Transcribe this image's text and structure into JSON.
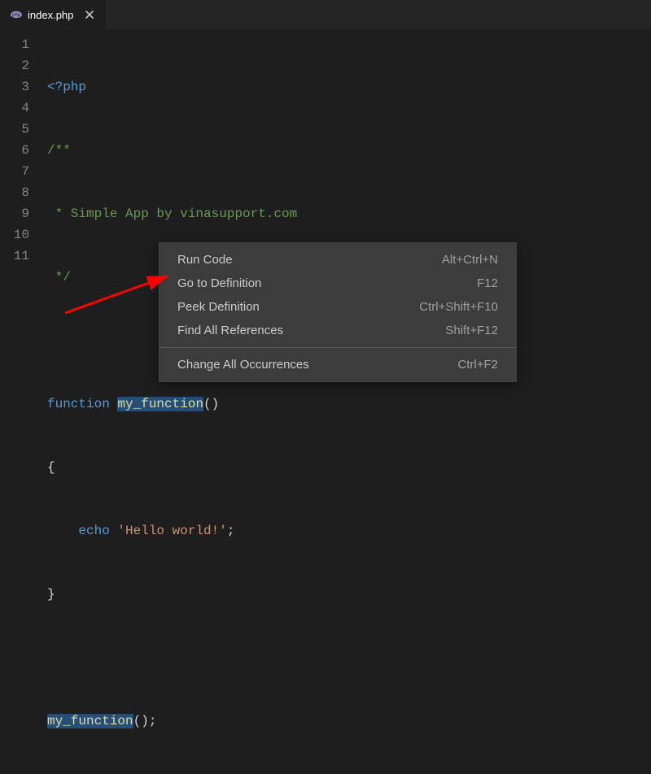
{
  "tab": {
    "filename": "index.php"
  },
  "gutter": [
    "1",
    "2",
    "3",
    "4",
    "5",
    "6",
    "7",
    "8",
    "9",
    "10",
    "11"
  ],
  "code": {
    "l1": "<?php",
    "l2": "/**",
    "l3": " * Simple App by vinasupport.com",
    "l4": " */",
    "l5": "",
    "l6_kw": "function",
    "l6_name": "my_function",
    "l6_paren": "()",
    "l7": "{",
    "l8_echo": "echo",
    "l8_str": "'Hello world!'",
    "l8_semi": ";",
    "l9": "}",
    "l11_call": "my_function",
    "l11_rest": "();"
  },
  "menu": {
    "items": [
      {
        "label": "Run Code",
        "shortcut": "Alt+Ctrl+N"
      },
      {
        "label": "Go to Definition",
        "shortcut": "F12"
      },
      {
        "label": "Peek Definition",
        "shortcut": "Ctrl+Shift+F10"
      },
      {
        "label": "Find All References",
        "shortcut": "Shift+F12"
      }
    ],
    "sep_after": 3,
    "items2": [
      {
        "label": "Change All Occurrences",
        "shortcut": "Ctrl+F2"
      }
    ]
  }
}
